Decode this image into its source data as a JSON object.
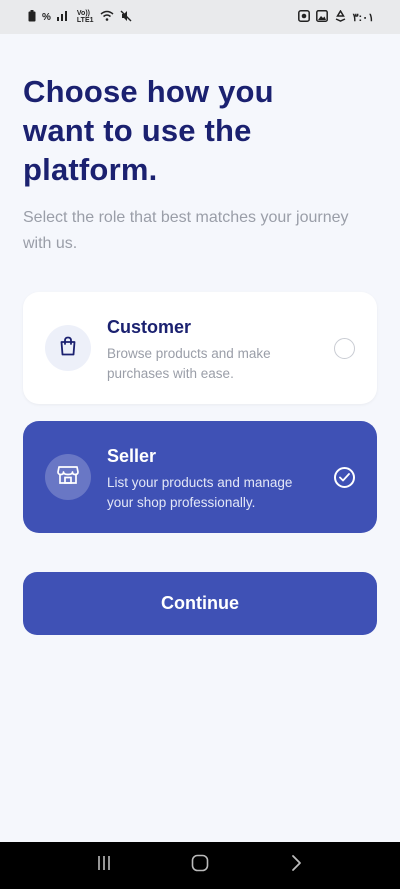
{
  "status_bar": {
    "left_percent": "%",
    "volte_label": "Vo))\nLTE1",
    "time": "٣:٠١",
    "icons": [
      "battery-icon",
      "signal-icon",
      "volte-icon",
      "wifi-icon",
      "mute-icon",
      "record-icon",
      "gallery-icon",
      "recycle-icon"
    ]
  },
  "header": {
    "title": "Choose how you want to use the platform.",
    "subtitle": "Select the role that best matches your journey with us."
  },
  "roles": [
    {
      "name": "Customer",
      "description": "Browse products and make purchases with ease.",
      "icon": "shopping-bag-icon",
      "selected": false
    },
    {
      "name": "Seller",
      "description": "List your products and manage your shop professionally.",
      "icon": "store-icon",
      "selected": true
    }
  ],
  "continue_label": "Continue",
  "colors": {
    "primary": "#3f51b5",
    "title": "#1b2170",
    "muted_text": "#9a9ea8",
    "background": "#f5f7fc"
  },
  "nav": {
    "icons": [
      "recent-apps-icon",
      "home-icon",
      "back-icon"
    ]
  }
}
